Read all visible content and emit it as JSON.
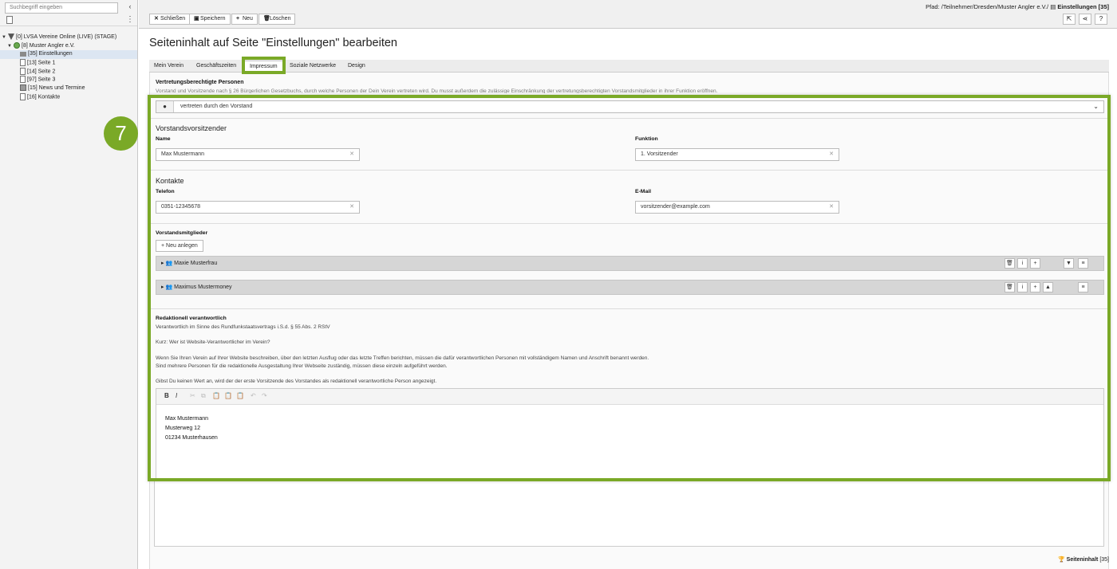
{
  "sidebar": {
    "search_placeholder": "Suchbegriff eingeben",
    "tree": [
      {
        "label": "[0] LVSA Vereine Online (LIVE) (STAGE)",
        "level": 0,
        "icon": "root-icon"
      },
      {
        "label": "[8] Muster Angler e.V.",
        "level": 1,
        "icon": "globe-icon"
      },
      {
        "label": "[35] Einstellungen",
        "level": 2,
        "icon": "settings-folder-icon",
        "selected": true
      },
      {
        "label": "[13] Seite 1",
        "level": 2,
        "icon": "page-icon"
      },
      {
        "label": "[14] Seite 2",
        "level": 2,
        "icon": "page-icon"
      },
      {
        "label": "[97] Seite 3",
        "level": 2,
        "icon": "page-icon"
      },
      {
        "label": "[15] News und Termine",
        "level": 2,
        "icon": "news-icon"
      },
      {
        "label": "[16] Kontakte",
        "level": 2,
        "icon": "page-icon"
      }
    ]
  },
  "toolbar": {
    "close": "Schließen",
    "save": "Speichern",
    "new": "Neu",
    "delete": "Löschen",
    "path_prefix": "Pfad: /Teilnehmer/Dresden/Muster Angler e.V./",
    "path_current": "Einstellungen [35]"
  },
  "page": {
    "title": "Seiteninhalt auf Seite \"Einstellungen\" bearbeiten",
    "tabs": [
      "Mein Verein",
      "Geschäftszeiten",
      "Impressum",
      "Soziale Netzwerke",
      "Design"
    ],
    "active_tab": "Impressum",
    "section_title": "Vertretungsberechtigte Personen",
    "section_desc": "Vorstand und Vorsitzende nach § 26 Bürgerlichen Gesetzbuchs, durch welche Personen der Dein Verein vertreten wird. Du musst außerdem die zulässige Einschränkung der vertretungsberechtigten Vorstandsmitglieder in ihrer Funktion eröffnen."
  },
  "badge": "7",
  "form": {
    "representation_select": "vertreten durch den Vorstand",
    "chairman_heading": "Vorstandsvorsitzender",
    "name_label": "Name",
    "name_value": "Max Mustermann",
    "function_label": "Funktion",
    "function_value": "1. Vorsitzender",
    "contacts_heading": "Kontakte",
    "phone_label": "Telefon",
    "phone_value": "0351-12345678",
    "email_label": "E-Mail",
    "email_value": "vorsitzender@example.com",
    "members_label": "Vorstandsmitglieder",
    "new_button": "Neu anlegen",
    "members": [
      "Maxie Musterfrau",
      "Maximus Mustermoney"
    ],
    "editorial_title": "Redaktionell verantwortlich",
    "editorial_lines": [
      "Verantwortlich im Sinne des Rundfunkstaatsvertrags i.S.d. § 55 Abs. 2 RStV",
      "Kurz: Wer ist Website-Verantwortlicher im Verein?",
      "Wenn Sie Ihren Verein auf Ihrer Website beschreiben, über den letzten Ausflug oder das letzte Treffen berichten, müssen die dafür verantwortlichen Personen mit vollständigem Namen und Anschrift benannt werden.",
      "Sind mehrere Personen für die redaktionelle Ausgestaltung Ihrer Webseite zuständig, müssen diese einzeln aufgeführt werden.",
      "Gibst Du keinen Wert an, wird der der erste Vorsitzende des Vorstandes als redaktionell verantwortliche Person angezeigt."
    ],
    "rte_lines": [
      "Max Mustermann",
      "Musterweg 12",
      "01234 Musterhausen"
    ]
  },
  "footer": {
    "label": "Seiteninhalt",
    "id": "[35]"
  }
}
